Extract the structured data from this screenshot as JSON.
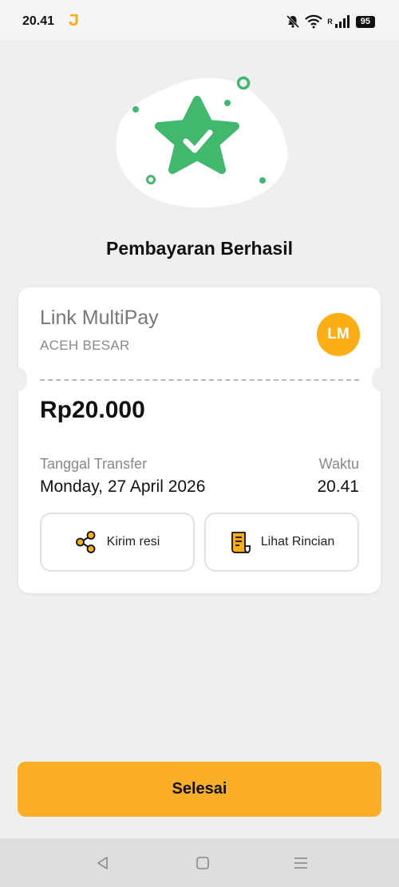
{
  "status_bar": {
    "time": "20.41",
    "battery": "95",
    "network_label": "R"
  },
  "page": {
    "title": "Pembayaran Berhasil"
  },
  "receipt": {
    "merchant_name": "Link MultiPay",
    "merchant_region": "ACEH BESAR",
    "avatar_initials": "LM",
    "amount": "Rp20.000",
    "date_label": "Tanggal Transfer",
    "date_value": "Monday, 27 April 2026",
    "time_label": "Waktu",
    "time_value": "20.41",
    "send_receipt_label": "Kirim resi",
    "view_details_label": "Lihat Rincian"
  },
  "actions": {
    "finish_label": "Selesai"
  },
  "colors": {
    "accent": "#fbae28",
    "success": "#41b86e",
    "avatar": "#fbae15"
  },
  "icons": [
    "notification-muted-icon",
    "wifi-icon",
    "signal-icon",
    "battery-icon",
    "star-check-icon",
    "share-icon",
    "receipt-icon",
    "back-icon",
    "home-icon",
    "recents-icon"
  ]
}
